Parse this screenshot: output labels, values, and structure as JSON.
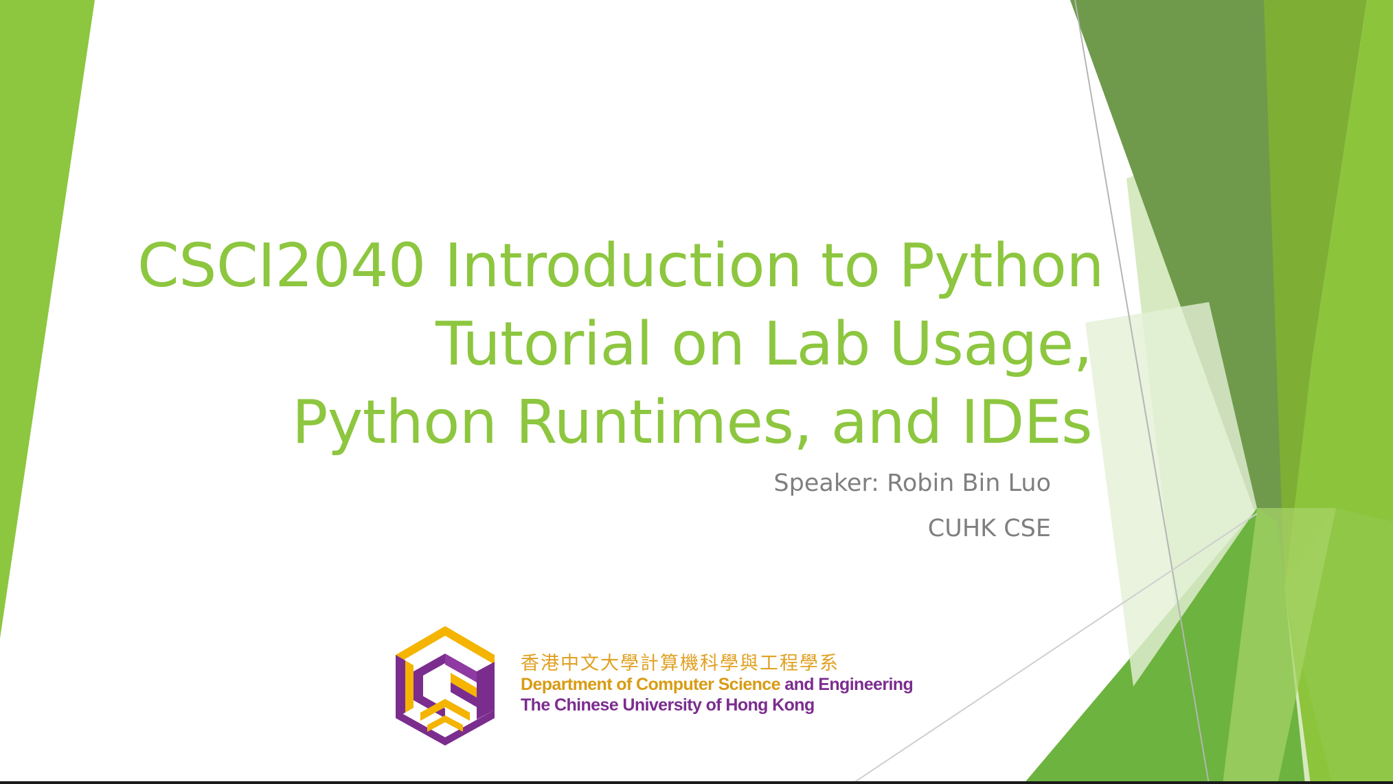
{
  "slide": {
    "title_lines": [
      "CSCI2040 Introduction to Python",
      "Tutorial on Lab Usage,",
      "Python Runtimes, and IDEs"
    ],
    "speaker": "Speaker: Robin Bin Luo",
    "affiliation": "CUHK CSE"
  },
  "logo": {
    "chinese_name": "香港中文大學計算機科學與工程學系",
    "dept_part1": "Department of Computer Science",
    "dept_part2": "and Engineering",
    "university": "The Chinese University of Hong Kong",
    "mark_icon": "cse-hexagon-logo-icon"
  },
  "colors": {
    "title": "#8dc63f",
    "subtitle": "#7f7f7f",
    "green_bright": "#8dc63f",
    "green_dark": "#5b8f2f",
    "logo_gold": "#e0a021",
    "logo_purple": "#7b2d8e"
  }
}
